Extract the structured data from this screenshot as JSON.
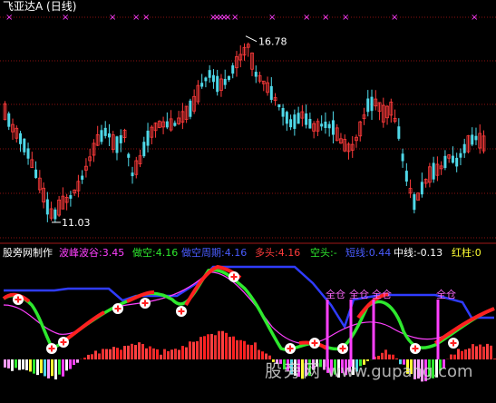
{
  "header": {
    "title": "飞亚达A (日线)",
    "high_label": "16.78",
    "low_label": "11.03"
  },
  "indicator": {
    "source": "股旁网制作",
    "wave": "波峰波谷:3.45",
    "short": "做空:4.16",
    "short_cycle": "做空周期:4.16",
    "long": "多头:4.16",
    "empty": "空头:-",
    "short_line": "短线:0.44",
    "mid_line": "中线:-0.13",
    "red_bar": "红柱:0"
  },
  "signal_label": "全仓",
  "watermark": {
    "site": "股旁网",
    "url": "www.gupang.com"
  },
  "colors": {
    "up": "#ff3b3b",
    "down": "#4fd8e8",
    "grid": "#8a1010",
    "blue_line": "#2f3cff",
    "green_line": "#2ee82e",
    "red_line": "#ff2020",
    "magenta": "#ff40ff",
    "white": "#ffffff",
    "yellow": "#ffff33"
  },
  "series_meta": {
    "candle_count": 125,
    "price_range": [
      10.6,
      17.4
    ],
    "high_price": 16.78,
    "low_price": 11.03
  }
}
